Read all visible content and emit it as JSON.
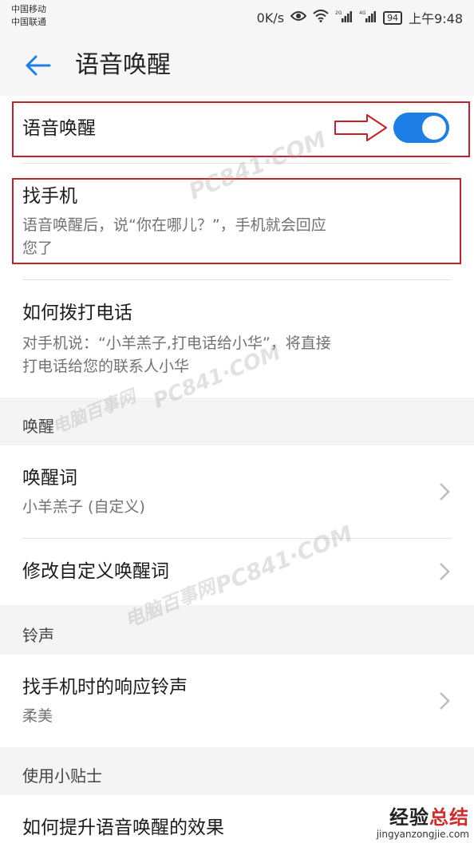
{
  "status": {
    "carrier_1": "中国移动",
    "carrier_2": "中国联通",
    "speed": "0K/s",
    "signal_1_tag": "2G",
    "signal_2_tag": "4G",
    "battery": "94",
    "time": "上午9:48"
  },
  "header": {
    "title": "语音唤醒"
  },
  "voice_wakeup": {
    "label": "语音唤醒",
    "enabled": true
  },
  "find_phone": {
    "title": "找手机",
    "subtitle_line1": "语音唤醒后，说“你在哪儿？”，手机就会回应",
    "subtitle_line2": "您了"
  },
  "how_to_call": {
    "title": "如何拨打电话",
    "subtitle_line1": "对手机说：“小羊羔子,打电话给小华”，将直接",
    "subtitle_line2": "打电话给您的联系人小华"
  },
  "sections": {
    "wake": "唤醒",
    "ringtone": "铃声",
    "tips": "使用小贴士"
  },
  "wake_word": {
    "title": "唤醒词",
    "value": "小羊羔子 (自定义)"
  },
  "edit_wake_word": {
    "title": "修改自定义唤醒词"
  },
  "ringtone_item": {
    "title": "找手机时的响应铃声",
    "value": "柔美"
  },
  "tips_item": {
    "title": "如何提升语音唤醒的效果"
  },
  "watermarks": {
    "site_en": "PC841·COM",
    "site_cn": "电脑百事网"
  },
  "brand": {
    "name_prefix": "经验",
    "name_suffix": "总结",
    "url": "jingyanzongjie.com"
  },
  "colors": {
    "accent": "#1d7fe6",
    "highlight_box": "#c4212a"
  }
}
